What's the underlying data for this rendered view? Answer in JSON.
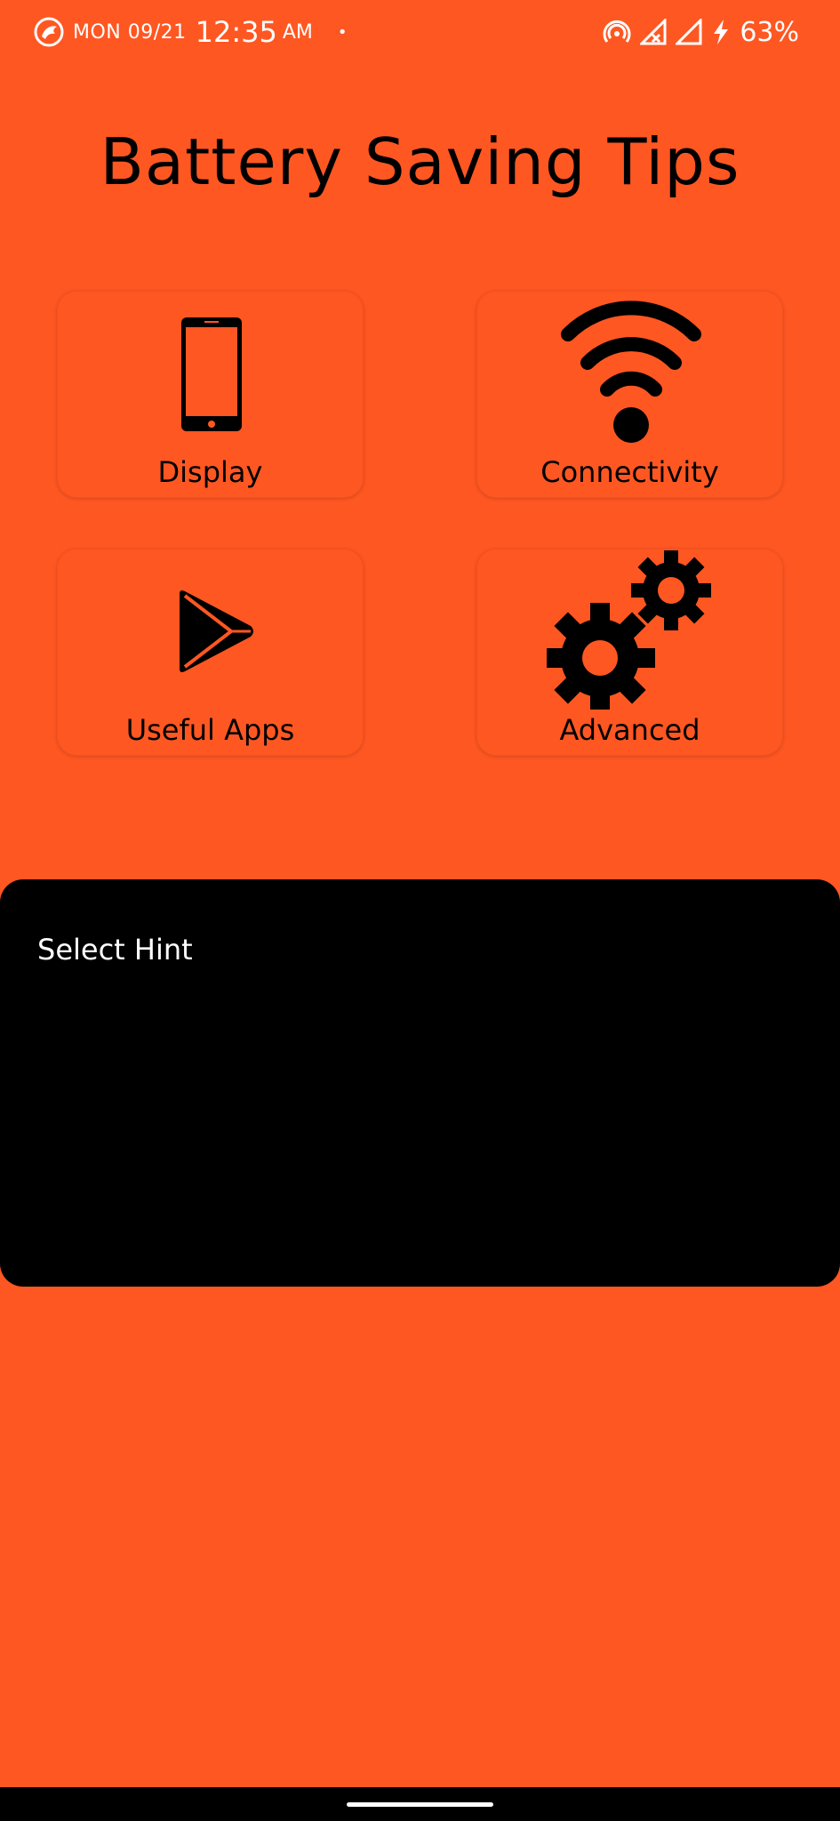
{
  "status_bar": {
    "day_date": "MON 09/21",
    "time": "12:35",
    "ampm": "AM",
    "notification_dot": "•",
    "battery": "63%"
  },
  "page": {
    "title": "Battery Saving Tips"
  },
  "tiles": [
    {
      "label": "Display",
      "icon": "smartphone-icon"
    },
    {
      "label": "Connectivity",
      "icon": "wifi-icon"
    },
    {
      "label": "Useful Apps",
      "icon": "play-store-icon"
    },
    {
      "label": "Advanced",
      "icon": "gears-icon"
    }
  ],
  "hint_panel": {
    "text": "Select Hint"
  },
  "colors": {
    "background": "#FF5722",
    "panel": "#000000",
    "text_dark": "#000000",
    "text_light": "#FFFFFF"
  }
}
